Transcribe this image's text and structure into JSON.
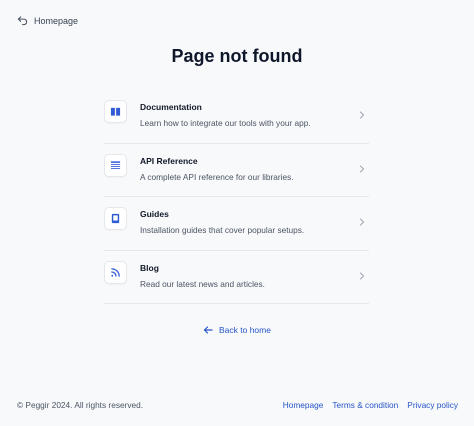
{
  "header": {
    "homepage_link": "Homepage"
  },
  "page": {
    "title": "Page not found"
  },
  "items": [
    {
      "title": "Documentation",
      "description": "Learn how to integrate our tools with your app.",
      "icon": "book-open-icon"
    },
    {
      "title": "API Reference",
      "description": "A complete API reference for our libraries.",
      "icon": "list-icon"
    },
    {
      "title": "Guides",
      "description": "Installation guides that cover popular setups.",
      "icon": "book-icon"
    },
    {
      "title": "Blog",
      "description": "Read our latest news and articles.",
      "icon": "rss-icon"
    }
  ],
  "back_link": "Back to home",
  "footer": {
    "copyright": "© Peggir 2024. All rights reserved.",
    "links": [
      "Homepage",
      "Terms & condition",
      "Privacy policy"
    ]
  },
  "colors": {
    "accent": "#2554c7",
    "icon": "#2f5bd3",
    "background": "#f8f9fb",
    "border": "#e5e7eb"
  }
}
